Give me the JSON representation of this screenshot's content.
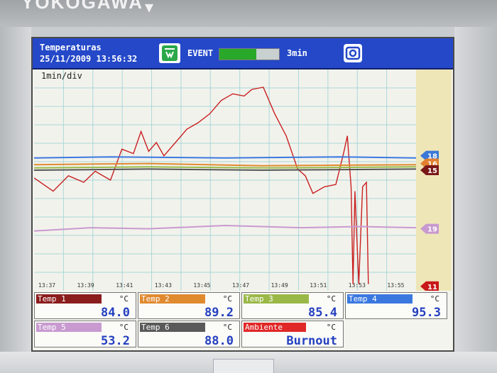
{
  "device": {
    "brand": "YOKOGAWA"
  },
  "header": {
    "title": "Temperaturas",
    "datetime": "25/11/2009 13:56:32",
    "event_label": "EVENT",
    "event_progress": 0.62,
    "event_interval": "3min"
  },
  "chart": {
    "div_label": "1min/div",
    "time_ticks": [
      "13:37",
      "13:39",
      "13:41",
      "13:43",
      "13:45",
      "13:47",
      "13:49",
      "13:51",
      "13:53",
      "13:55"
    ],
    "markers": [
      {
        "label": "18",
        "color": "#3a78d8"
      },
      {
        "label": "16",
        "color": "#e08030"
      },
      {
        "label": "15",
        "color": "#7a1818"
      },
      {
        "label": "19",
        "color": "#c89ad0"
      },
      {
        "label": "11",
        "color": "#c81818"
      }
    ]
  },
  "chart_data": {
    "type": "line",
    "x": [
      "13:37",
      "13:39",
      "13:41",
      "13:43",
      "13:45",
      "13:47",
      "13:49",
      "13:51",
      "13:53",
      "13:55"
    ],
    "series": [
      {
        "name": "Temp 1",
        "color": "#c82020"
      },
      {
        "name": "Temp 2",
        "color": "#e08a30"
      },
      {
        "name": "Temp 3",
        "color": "#9aba48"
      },
      {
        "name": "Temp 4",
        "color": "#3a78e0"
      },
      {
        "name": "Temp 5",
        "color": "#c89ad0"
      },
      {
        "name": "Temp 6",
        "color": "#555555"
      }
    ]
  },
  "channels": [
    {
      "name": "Temp 1",
      "unit": "°C",
      "value": "84.0",
      "color": "#8a1c1c"
    },
    {
      "name": "Temp 2",
      "unit": "°C",
      "value": "89.2",
      "color": "#e08a30"
    },
    {
      "name": "Temp 3",
      "unit": "°C",
      "value": "85.4",
      "color": "#9ab848"
    },
    {
      "name": "Temp 4",
      "unit": "°C",
      "value": "95.3",
      "color": "#3a78e0"
    },
    {
      "name": "Temp 5",
      "unit": "°C",
      "value": "53.2",
      "color": "#c89ad0"
    },
    {
      "name": "Temp 6",
      "unit": "°C",
      "value": "88.0",
      "color": "#5a5a5a"
    },
    {
      "name": "Ambiente",
      "unit": "°C",
      "value": "Burnout",
      "color": "#e02828"
    }
  ]
}
